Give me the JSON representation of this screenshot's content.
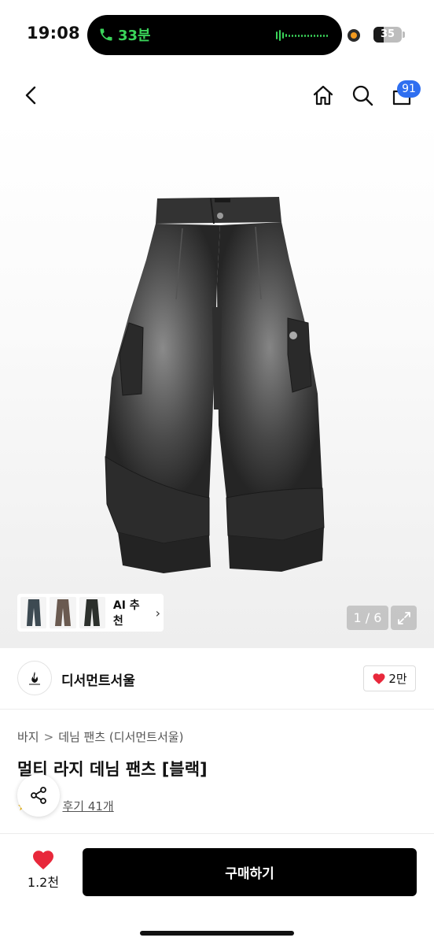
{
  "status_bar": {
    "time": "19:08",
    "call_duration": "33분",
    "battery_level": "35",
    "battery_fraction": 0.35,
    "accent_call_color": "#3ad45a"
  },
  "nav": {
    "back_icon": "chevron-left-icon",
    "home_icon": "home-icon",
    "search_icon": "search-icon",
    "bag_icon": "shopping-bag-icon",
    "bag_badge": "91",
    "badge_color": "#2f6ff0"
  },
  "gallery": {
    "ai_recommend_label": "AI 추천",
    "ai_recommend_chevron": "›",
    "page_indicator": "1 / 6",
    "expand_icon": "expand-icon",
    "thumbnails": [
      "thumb-1",
      "thumb-2",
      "thumb-3"
    ]
  },
  "brand": {
    "name": "디서먼트서울",
    "likes": "2만",
    "like_icon": "heart-icon"
  },
  "product": {
    "breadcrumb": [
      "바지",
      "데님 팬츠 (디서먼트서울)"
    ],
    "breadcrumb_sep": ">",
    "title": "멀티 라지 데님 팬츠 [블랙]",
    "reviews_label": "후기 41개",
    "share_icon": "share-icon"
  },
  "action_bar": {
    "wish_count": "1.2천",
    "buy_label": "구매하기",
    "wish_color": "#e8283b"
  }
}
